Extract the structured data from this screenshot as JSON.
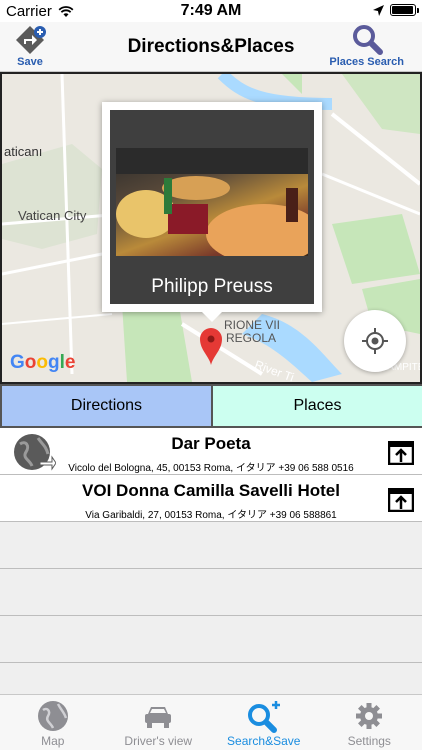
{
  "status_bar": {
    "carrier": "Carrier",
    "time": "7:49 AM",
    "battery_level": 0.95
  },
  "nav": {
    "title": "Directions&Places",
    "left_button": "Save",
    "right_button": "Places Search"
  },
  "map": {
    "labels": {
      "vatican_short": "aticanı",
      "vatican_city": "Vatican City",
      "rione": "RIONE VII",
      "regola": "REGOLA",
      "river": "River Ti",
      "edge": "CAMPITELL"
    },
    "logo": "Google",
    "callout_name": "Philipp Preuss"
  },
  "segment": {
    "directions": "Directions",
    "places": "Places"
  },
  "list": [
    {
      "title": "Dar Poeta",
      "address": "Vicolo del Bologna, 45, 00153 Roma, イタリア +39 06 588 0516"
    },
    {
      "title": "VOI Donna Camilla Savelli Hotel",
      "address": "Via Garibaldi, 27, 00153 Roma, イタリア +39 06 588861"
    }
  ],
  "tabs": [
    {
      "label": "Map",
      "icon": "globe-icon"
    },
    {
      "label": "Driver's view",
      "icon": "car-icon"
    },
    {
      "label": "Search&Save",
      "icon": "search-add-icon"
    },
    {
      "label": "Settings",
      "icon": "gear-icon"
    }
  ],
  "colors": {
    "accent": "#1a8de0",
    "nav_blue": "#2a5db0",
    "directions_bg": "#a9c6f7",
    "places_bg": "#ccfff0"
  }
}
